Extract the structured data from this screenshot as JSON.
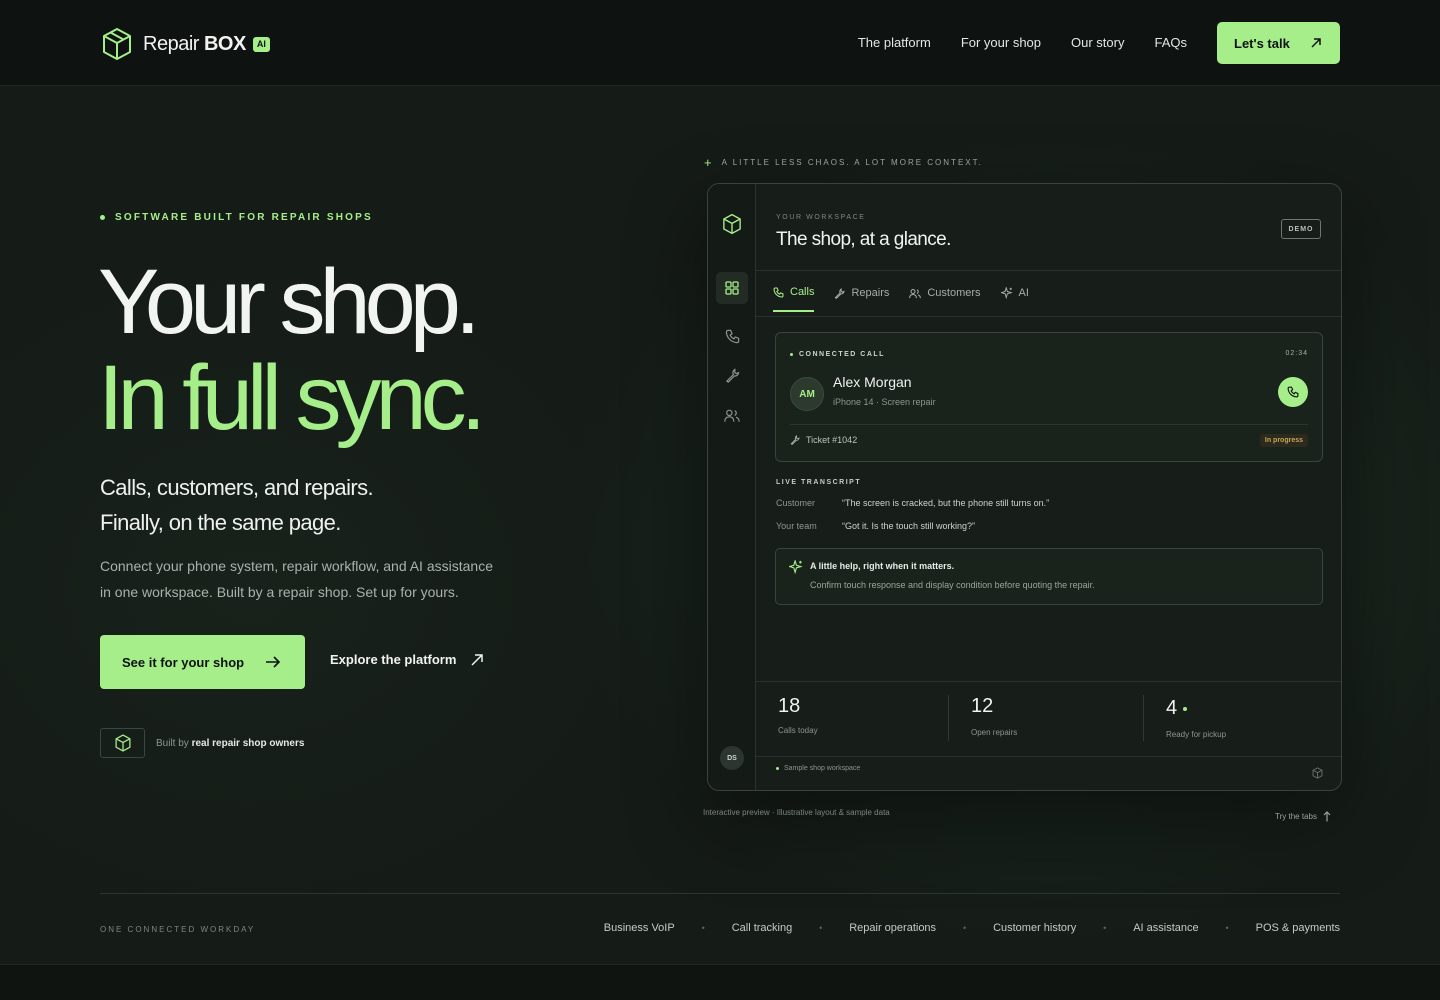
{
  "brand": {
    "name_light": "Repair",
    "name_bold": "BOX",
    "badge": "AI"
  },
  "nav": {
    "items": [
      "The platform",
      "For your shop",
      "Our story",
      "FAQs"
    ],
    "cta": "Let's talk"
  },
  "hero": {
    "eyebrow": "SOFTWARE BUILT FOR REPAIR SHOPS",
    "headline_1": "Your shop.",
    "headline_2": "In full sync.",
    "sub_1": "Calls, customers, and repairs.",
    "sub_2": "Finally, on the same page.",
    "desc_1": "Connect your phone system, repair workflow, and AI assistance",
    "desc_2": "in one workspace. Built by a repair shop. Set up for yours.",
    "primary_cta": "See it for your shop",
    "secondary_cta": "Explore the platform",
    "built_prefix": "Built by",
    "built_bold": "real repair shop owners"
  },
  "preview": {
    "eyebrow": "A LITTLE LESS CHAOS. A LOT MORE CONTEXT.",
    "workspace_label": "YOUR WORKSPACE",
    "workspace_title": "The shop, at a glance.",
    "demo_badge": "DEMO",
    "tabs": [
      "Calls",
      "Repairs",
      "Customers",
      "AI"
    ],
    "call": {
      "label": "CONNECTED CALL",
      "time": "02:34",
      "initials": "AM",
      "name": "Alex Morgan",
      "device": "iPhone 14 · Screen repair",
      "ticket": "Ticket #1042",
      "status": "In progress"
    },
    "transcript": {
      "label": "LIVE TRANSCRIPT",
      "rows": [
        {
          "who": "Customer",
          "text": "“The screen is cracked, but the phone still turns on.”"
        },
        {
          "who": "Your team",
          "text": "“Got it. Is the touch still working?”"
        }
      ]
    },
    "ai": {
      "title": "A little help, right when it matters.",
      "text": "Confirm touch response and display condition before quoting the repair."
    },
    "stats": [
      {
        "value": "18",
        "label": "Calls today"
      },
      {
        "value": "12",
        "label": "Open repairs"
      },
      {
        "value": "4",
        "label": "Ready for pickup"
      }
    ],
    "user_initials": "DS",
    "sample_label": "Sample shop workspace",
    "caption_left": "Interactive preview · Illustrative layout & sample data",
    "caption_right": "Try the tabs"
  },
  "footer": {
    "label": "ONE CONNECTED WORKDAY",
    "features": [
      "Business VoIP",
      "Call tracking",
      "Repair operations",
      "Customer history",
      "AI assistance",
      "POS & payments"
    ]
  },
  "colors": {
    "accent": "#a6ee8a",
    "background": "#121714",
    "panel": "#171e19"
  }
}
